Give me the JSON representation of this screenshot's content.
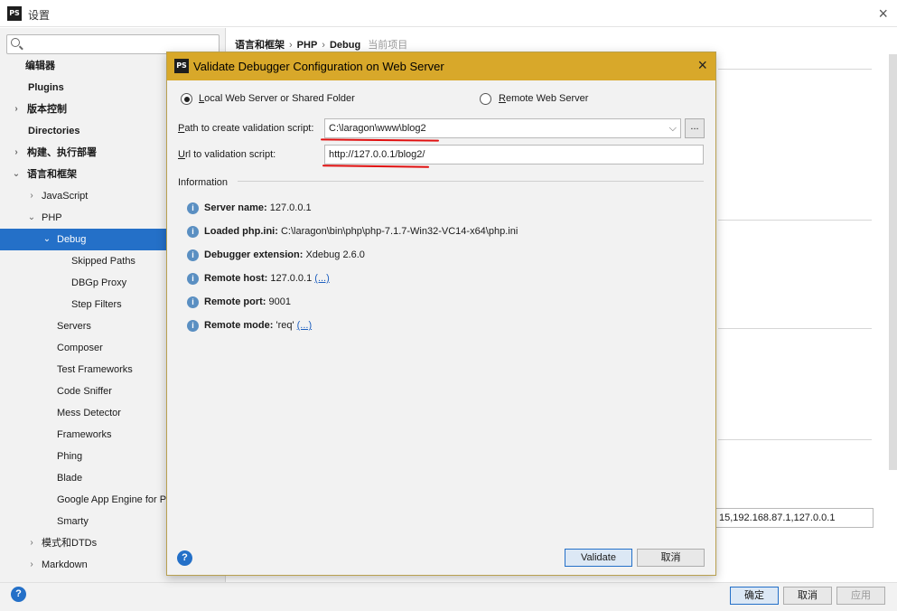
{
  "window": {
    "title": "设置"
  },
  "search": {
    "placeholder": ""
  },
  "sidebar": {
    "items": [
      {
        "label": "编辑器",
        "bold": true
      },
      {
        "label": "Plugins",
        "bold": true
      },
      {
        "label": "版本控制",
        "bold": true
      },
      {
        "label": "Directories",
        "bold": true
      },
      {
        "label": "构建、执行部署",
        "bold": true
      },
      {
        "label": "语言和框架",
        "bold": true
      },
      {
        "label": "JavaScript"
      },
      {
        "label": "PHP"
      },
      {
        "label": "Debug",
        "selected": true
      },
      {
        "label": "Skipped Paths"
      },
      {
        "label": "DBGp Proxy"
      },
      {
        "label": "Step Filters"
      },
      {
        "label": "Servers"
      },
      {
        "label": "Composer"
      },
      {
        "label": "Test Frameworks"
      },
      {
        "label": "Code Sniffer"
      },
      {
        "label": "Mess Detector"
      },
      {
        "label": "Frameworks"
      },
      {
        "label": "Phing"
      },
      {
        "label": "Blade"
      },
      {
        "label": "Google App Engine for PH"
      },
      {
        "label": "Smarty"
      },
      {
        "label": "模式和DTDs"
      },
      {
        "label": "Markdown"
      }
    ]
  },
  "breadcrumb": {
    "part1": "语言和框架",
    "sep": "›",
    "part2": "PHP",
    "part3": "Debug",
    "project": "当前项目"
  },
  "background": {
    "ip_field": "15,192.168.87.1,127.0.0.1"
  },
  "footer": {
    "ok": "确定",
    "cancel": "取消",
    "apply": "应用"
  },
  "dialog": {
    "title": "Validate Debugger Configuration on Web Server",
    "radio_local": {
      "mnemonic": "L",
      "rest": "ocal Web Server or Shared Folder"
    },
    "radio_remote": {
      "mnemonic": "R",
      "rest": "emote Web Server"
    },
    "path_label": {
      "mnemonic": "P",
      "rest": "ath to create validation script:"
    },
    "path_value": "C:\\laragon\\www\\blog2",
    "url_label": {
      "mnemonic": "U",
      "rest": "rl to validation script:"
    },
    "url_value": "http://127.0.0.1/blog2/",
    "browse": "...",
    "information": "Information",
    "info": [
      {
        "key": "Server name:",
        "value": " 127.0.0.1"
      },
      {
        "key": "Loaded php.ini:",
        "value": " C:\\laragon\\bin\\php\\php-7.1.7-Win32-VC14-x64\\php.ini"
      },
      {
        "key": "Debugger extension:",
        "value": " Xdebug 2.6.0"
      },
      {
        "key": "Remote host:",
        "value": " 127.0.0.1 ",
        "link": "(...)"
      },
      {
        "key": "Remote port:",
        "value": " 9001"
      },
      {
        "key": "Remote mode:",
        "value": " 'req' ",
        "link": "(...)"
      }
    ],
    "validate": "Validate",
    "cancel": "取消"
  },
  "icons": {
    "logo": "PS",
    "help": "?",
    "close": "×",
    "info": "i"
  },
  "colors": {
    "dialog_title": "#d8a82a",
    "selection": "#2470c8",
    "annotation": "#e01010"
  }
}
